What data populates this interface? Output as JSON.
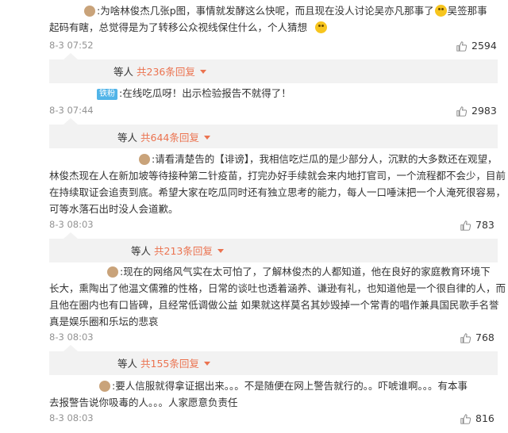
{
  "comments": [
    {
      "lines": [
        ":为啥林俊杰几张p图，事情就发酵这么快呢，而且现在没人讨论吴亦凡那事了",
        "起码有瞎，总觉得是为了转移公众视线保住什么，个人猜想"
      ],
      "line1_tail": "吴签那事",
      "time": "8-3 07:52",
      "likes": "2594",
      "replies_prefix": "等人",
      "replies_count": "共236条回复"
    },
    {
      "badge": "铁粉",
      "lines": [
        ":在线吃瓜呀！出示检验报告不就得了！"
      ],
      "time": "8-3 07:44",
      "likes": "2983",
      "replies_prefix": "等人",
      "replies_count": "共644条回复"
    },
    {
      "lines": [
        ":请看清楚告的【诽谤】，我相信吃烂瓜的是少部分人，沉默的大多数还在观望，",
        "林俊杰现在人在新加坡等待接种第二针疫苗，打完办好手续就会来内地打官司，一个流程都不会少，目前",
        "在持续取证会追责到底。希望大家在吃瓜同时还有独立思考的能力，每人一口唾沫把一个人淹死很容易，",
        "可等水落石出时没人会道歉。"
      ],
      "time": "8-3 08:03",
      "likes": "783",
      "replies_prefix": "等人",
      "replies_count": "共213条回复"
    },
    {
      "lines": [
        ":现在的网络风气实在太可怕了，了解林俊杰的人都知道，他在良好的家庭教育环境下",
        "长大，熏陶出了他温文儒雅的性格，日常的谈吐也透着涵养、谦逊有礼，也知道他是一个很自律的人，而",
        "且他在圈内也有口皆碑，且经常低调做公益 如果就这样莫名其妙毁掉一个常青的唱作兼具国民歌手名誉",
        "真是娱乐圈和乐坛的悲哀"
      ],
      "time": "8-3 08:03",
      "likes": "768",
      "replies_prefix": "等人",
      "replies_count": "共155条回复"
    },
    {
      "lines": [
        ":要人信服就得拿证据出来。。。不是随便在网上警告就行的。。吓唬谁啊。。。有本事",
        "去报警告说你吸毒的人。。。人家愿意负责任"
      ],
      "time": "8-3 08:03",
      "likes": "816"
    }
  ],
  "colors": {
    "accent": "#eb7350",
    "meta": "#939393",
    "text": "#333333",
    "badge": "#51b4e8"
  },
  "icons": {
    "like": "thumbs-up-icon",
    "emoji": "grin-emoji-icon",
    "caret": "caret-down-icon"
  }
}
